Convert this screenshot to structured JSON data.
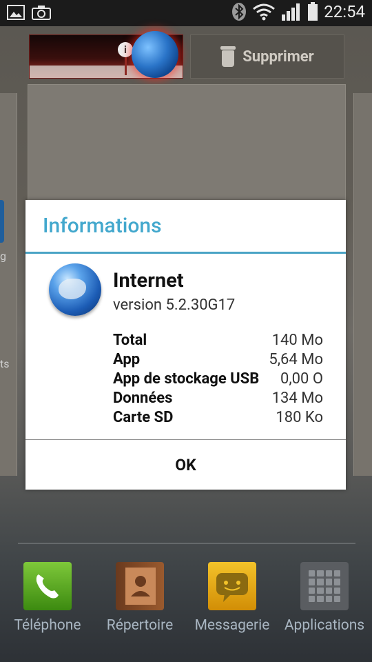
{
  "status_bar": {
    "time": "22:54",
    "icons": [
      "picture-icon",
      "camera-icon",
      "bluetooth-icon",
      "wifi-icon",
      "signal-icon",
      "battery-icon"
    ]
  },
  "drop_targets": {
    "delete_label": "Supprimer"
  },
  "dialog": {
    "title": "Informations",
    "app_name": "Internet",
    "version": "version 5.2.30G17",
    "rows": [
      {
        "label": "Total",
        "value": "140 Mo"
      },
      {
        "label": "App",
        "value": "5,64 Mo"
      },
      {
        "label": "App de stockage USB",
        "value": "0,00 O"
      },
      {
        "label": "Données",
        "value": "134 Mo"
      },
      {
        "label": "Carte SD",
        "value": "180 Ko"
      }
    ],
    "ok_label": "OK"
  },
  "dock": {
    "items": [
      {
        "label": "Téléphone",
        "icon": "phone-icon"
      },
      {
        "label": "Répertoire",
        "icon": "contacts-icon"
      },
      {
        "label": "Messagerie",
        "icon": "messaging-icon"
      },
      {
        "label": "Applications",
        "icon": "apps-icon"
      }
    ]
  },
  "left_edge": {
    "label_1": "g",
    "label_2": "ts"
  },
  "colors": {
    "accent": "#43a8cd",
    "status_bar": "#1b1b1b"
  }
}
